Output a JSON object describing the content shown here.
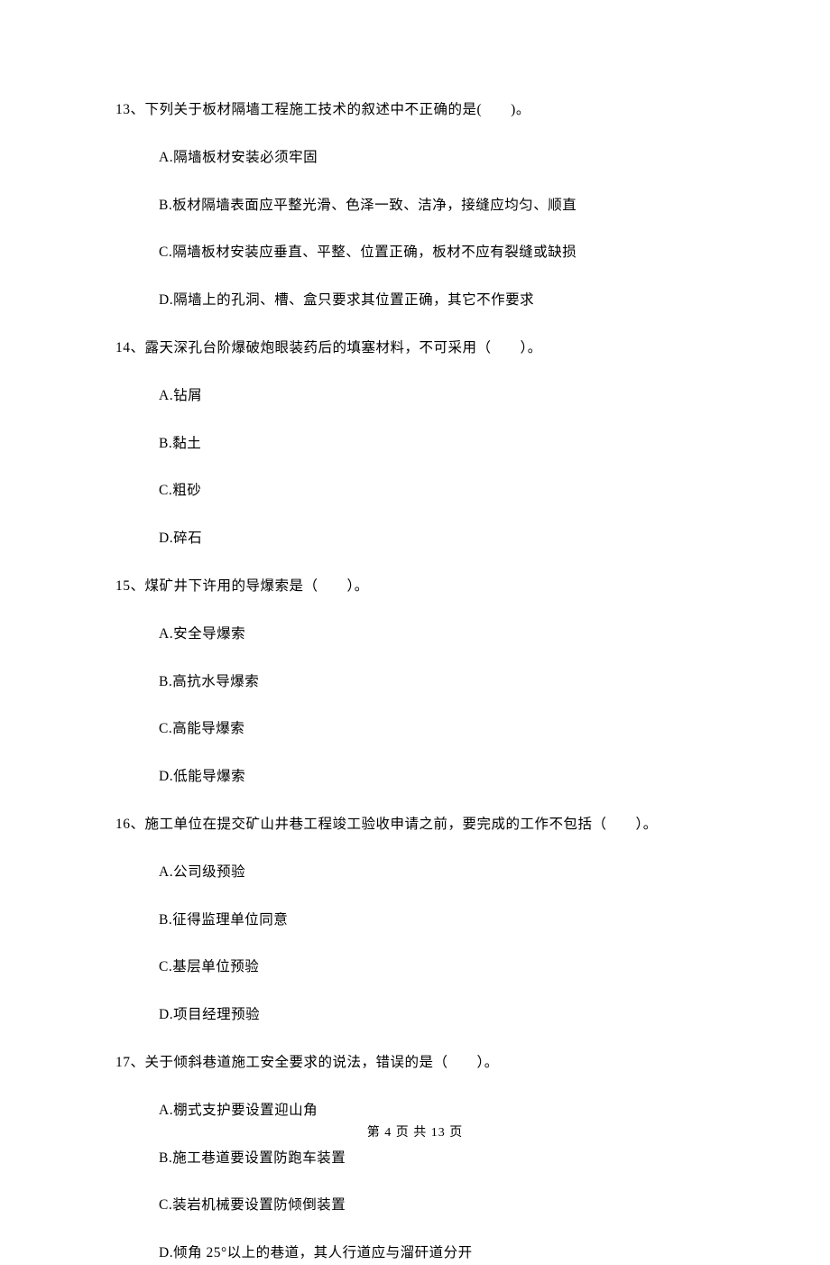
{
  "questions": [
    {
      "number": "13、",
      "stem": "下列关于板材隔墙工程施工技术的叙述中不正确的是(　　)。",
      "options": [
        "A.隔墙板材安装必须牢固",
        "B.板材隔墙表面应平整光滑、色泽一致、洁净，接缝应均匀、顺直",
        "C.隔墙板材安装应垂直、平整、位置正确，板材不应有裂缝或缺损",
        "D.隔墙上的孔洞、槽、盒只要求其位置正确，其它不作要求"
      ]
    },
    {
      "number": "14、",
      "stem": "露天深孔台阶爆破炮眼装药后的填塞材料，不可采用（　　）。",
      "options": [
        "A.钻屑",
        "B.黏土",
        "C.粗砂",
        "D.碎石"
      ]
    },
    {
      "number": "15、",
      "stem": "煤矿井下许用的导爆索是（　　）。",
      "options": [
        "A.安全导爆索",
        "B.高抗水导爆索",
        "C.高能导爆索",
        "D.低能导爆索"
      ]
    },
    {
      "number": "16、",
      "stem": "施工单位在提交矿山井巷工程竣工验收申请之前，要完成的工作不包括（　　）。",
      "options": [
        "A.公司级预验",
        "B.征得监理单位同意",
        "C.基层单位预验",
        "D.项目经理预验"
      ]
    },
    {
      "number": "17、",
      "stem": "关于倾斜巷道施工安全要求的说法，错误的是（　　）。",
      "options": [
        "A.棚式支护要设置迎山角",
        "B.施工巷道要设置防跑车装置",
        "C.装岩机械要设置防倾倒装置",
        "D.倾角 25°以上的巷道，其人行道应与溜矸道分开"
      ]
    }
  ],
  "footer": "第 4 页 共 13 页"
}
